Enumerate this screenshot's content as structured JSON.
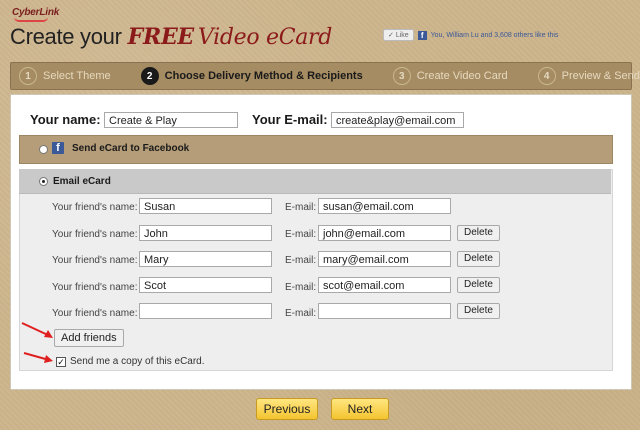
{
  "header": {
    "logo": "CyberLink",
    "title_plain": "Create your",
    "title_free": "FREE",
    "title_rest": "Video eCard",
    "like_label": "Like",
    "like_text": "You, William Lu and 3,608 others like this"
  },
  "steps": [
    {
      "num": "1",
      "label": "Select Theme",
      "active": false
    },
    {
      "num": "2",
      "label": "Choose Delivery Method & Recipients",
      "active": true
    },
    {
      "num": "3",
      "label": "Create Video Card",
      "active": false
    },
    {
      "num": "4",
      "label": "Preview & Send",
      "active": false
    }
  ],
  "sender": {
    "name_label": "Your name:",
    "name_value": "Create & Play",
    "email_label": "Your E-mail:",
    "email_value": "create&play@email.com"
  },
  "delivery": {
    "facebook_label": "Send eCard to Facebook",
    "email_label": "Email eCard"
  },
  "friends": {
    "name_label": "Your friend's name:",
    "email_label": "E-mail:",
    "delete_label": "Delete",
    "rows": [
      {
        "name": "Susan",
        "email": "susan@email.com",
        "deletable": false
      },
      {
        "name": "John",
        "email": "john@email.com",
        "deletable": true
      },
      {
        "name": "Mary",
        "email": "mary@email.com",
        "deletable": true
      },
      {
        "name": "Scot",
        "email": "scot@email.com",
        "deletable": true
      },
      {
        "name": "",
        "email": "",
        "deletable": true
      }
    ]
  },
  "add_friends_label": "Add friends",
  "copy_label": "Send me a copy of this eCard.",
  "nav": {
    "previous": "Previous",
    "next": "Next"
  },
  "colors": {
    "accent_red": "#8b1a1a",
    "steps_bar": "#a58c62",
    "facebook_row": "#b49d78",
    "button_yellow": "#f4c430"
  }
}
